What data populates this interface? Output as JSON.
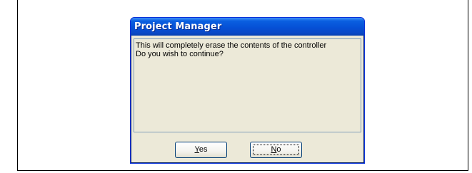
{
  "dialog": {
    "title": "Project Manager",
    "message_lines": [
      "This will completely erase the contents of the controller",
      "Do you wish to continue?"
    ],
    "buttons": {
      "yes": {
        "mnemonic": "Y",
        "rest": "es"
      },
      "no": {
        "mnemonic": "N",
        "rest": "o"
      }
    }
  },
  "colors": {
    "titlebar": "#0550d6",
    "dialog_face": "#ece9d8",
    "button_border": "#003c74"
  }
}
